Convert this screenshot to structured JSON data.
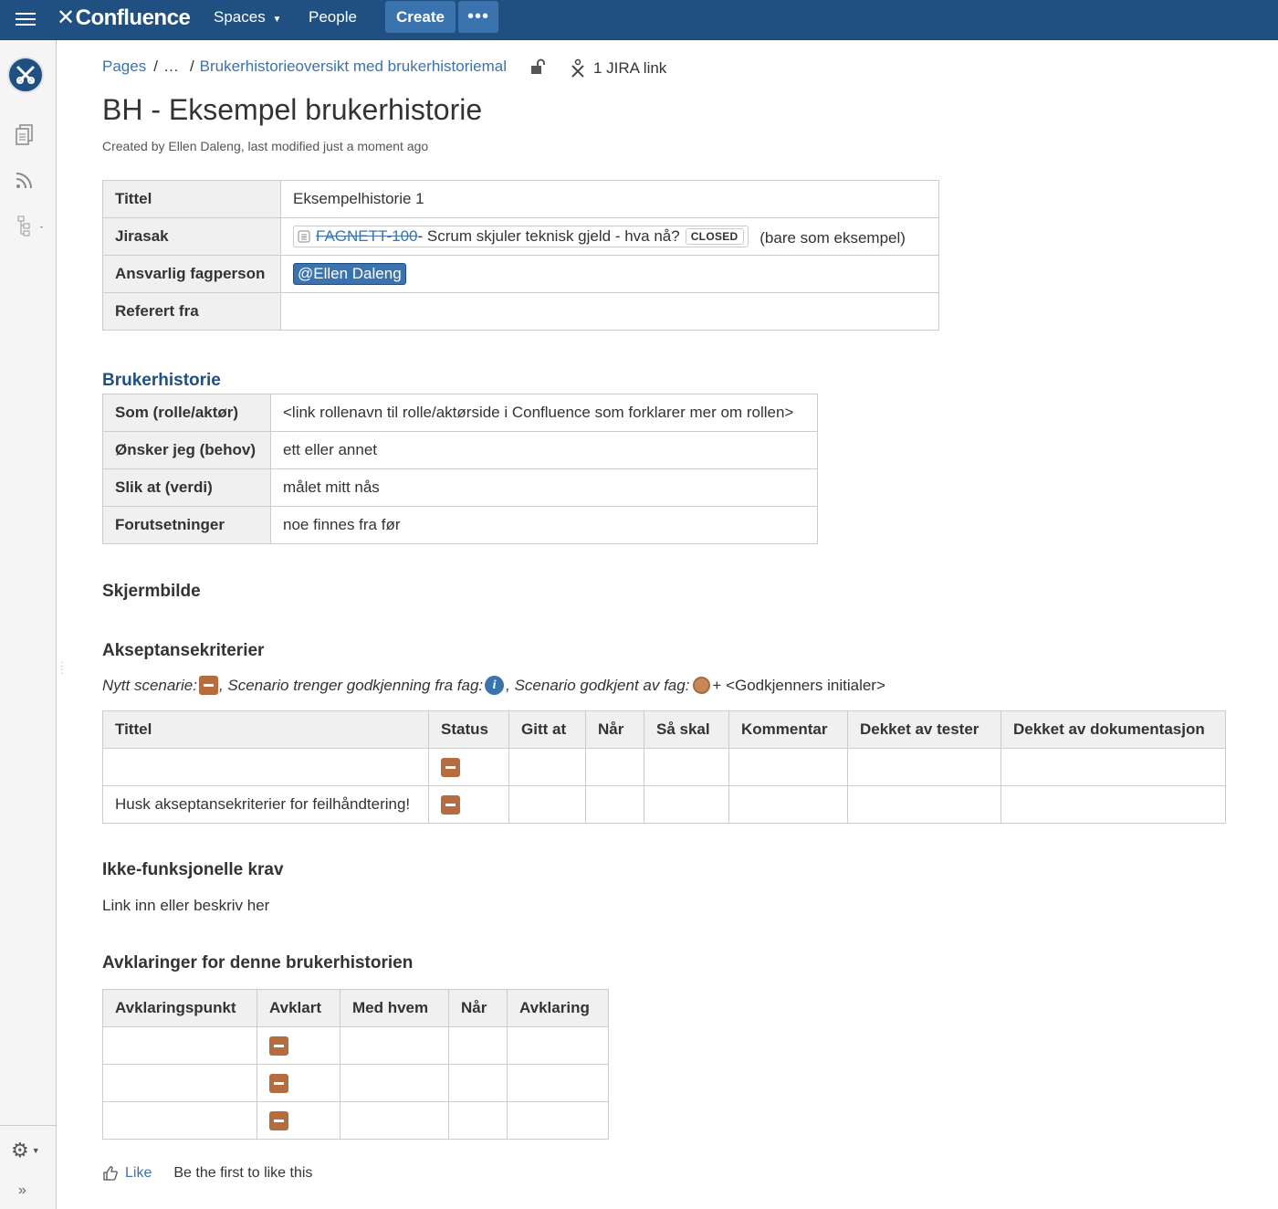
{
  "nav": {
    "logo": "Confluence",
    "spaces_label": "Spaces",
    "people_label": "People",
    "create_label": "Create",
    "more_label": "•••"
  },
  "breadcrumb": {
    "pages": "Pages",
    "ellipsis": "…",
    "parent": "Brukerhistorieoversikt med brukerhistoriemal",
    "jira_link": "1 JIRA link"
  },
  "page": {
    "title": "BH - Eksempel brukerhistorie",
    "byline": "Created by Ellen Daleng, last modified just a moment ago"
  },
  "info_table": {
    "rows": [
      {
        "label": "Tittel",
        "value": "Eksempelhistorie 1"
      },
      {
        "label": "Jirasak",
        "jira_key": "FAGNETT-100",
        "jira_summary": " - Scrum skjuler teknisk gjeld - hva nå?",
        "jira_status": "CLOSED",
        "note": "(bare som eksempel)"
      },
      {
        "label": "Ansvarlig fagperson",
        "mention": "@Ellen Daleng"
      },
      {
        "label": "Referert fra",
        "value": ""
      }
    ]
  },
  "brukerhistorie": {
    "heading": "Brukerhistorie",
    "rows": [
      {
        "label": "Som (rolle/aktør)",
        "value": "<link rollenavn til rolle/aktørside i Confluence som forklarer mer om rollen>"
      },
      {
        "label": "Ønsker jeg (behov)",
        "value": "ett eller annet"
      },
      {
        "label": "Slik at (verdi)",
        "value": "målet mitt nås"
      },
      {
        "label": "Forutsetninger",
        "value": "noe finnes fra før"
      }
    ]
  },
  "skjermbilde": {
    "heading": "Skjermbilde"
  },
  "akseptanse": {
    "heading": "Akseptansekriterier",
    "legend": {
      "part1": "Nytt scenarie: ",
      "part2": ", Scenario trenger godkjenning fra fag: ",
      "part3": ", Scenario godkjent av fag: ",
      "part4": " + <Godkjenners initialer>"
    },
    "columns": [
      "Tittel",
      "Status",
      "Gitt at",
      "Når",
      "Så skal",
      "Kommentar",
      "Dekket av tester",
      "Dekket av dokumentasjon"
    ],
    "rows": [
      {
        "tittel": ""
      },
      {
        "tittel": "Husk akseptansekriterier for feilhåndtering!"
      }
    ]
  },
  "ikke_funksjonelle": {
    "heading": "Ikke-funksjonelle krav",
    "text": "Link inn eller beskriv her"
  },
  "avklaringer": {
    "heading": "Avklaringer for denne brukerhistorien",
    "columns": [
      "Avklaringspunkt",
      "Avklart",
      "Med hvem",
      "Når",
      "Avklaring"
    ],
    "row_count": 3
  },
  "like": {
    "label": "Like",
    "text": "Be the first to like this"
  },
  "colors": {
    "nav_bg": "#205081",
    "link": "#3b73af",
    "status_minus": "#b56c3e"
  }
}
